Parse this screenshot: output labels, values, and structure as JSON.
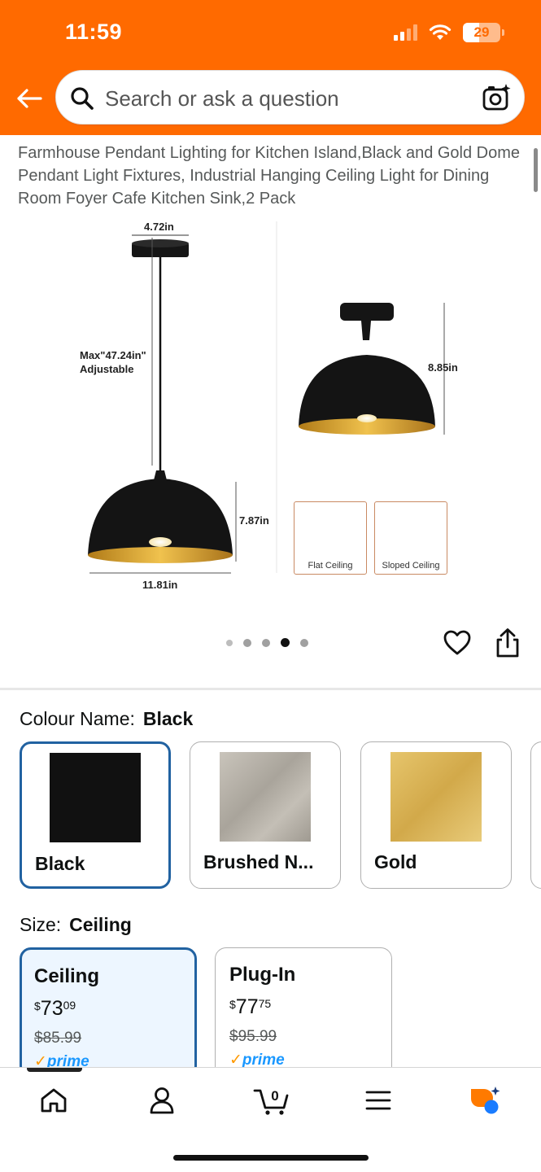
{
  "status_bar": {
    "time": "11:59",
    "battery": "29"
  },
  "search": {
    "placeholder": "Search or ask a question"
  },
  "product": {
    "title": "Farmhouse Pendant Lighting for Kitchen Island,Black and Gold Dome Pendant Light Fixtures, Industrial Hanging Ceiling Light for Dining Room Foyer Cafe Kitchen Sink,2 Pack"
  },
  "product_image": {
    "canopy_width": "4.72in",
    "cord_length": "Max\"47.24in\"",
    "cord_note": "Adjustable",
    "shade_height": "7.87in",
    "shade_width": "11.81in",
    "flush_height": "8.85in",
    "flat_ceiling": "Flat Ceiling",
    "sloped_ceiling": "Sloped Ceiling"
  },
  "carousel": {
    "total": 5,
    "active_index": 3
  },
  "colour": {
    "label": "Colour Name:",
    "selected": "Black",
    "options": [
      {
        "name": "Black",
        "color": "#111111"
      },
      {
        "name": "Brushed N...",
        "color": "#b8b3aa"
      },
      {
        "name": "Gold",
        "color": "#d9b55a"
      }
    ]
  },
  "size": {
    "label": "Size:",
    "selected": "Ceiling",
    "options": [
      {
        "name": "Ceiling",
        "currency": "$",
        "price_whole": "73",
        "price_fraction": "09",
        "was_price": "$85.99",
        "prime": "prime"
      },
      {
        "name": "Plug-In",
        "currency": "$",
        "price_whole": "77",
        "price_fraction": "75",
        "was_price": "$95.99",
        "prime": "prime"
      }
    ]
  },
  "cart": {
    "count": "0"
  },
  "bottom_nav": [
    "home",
    "account",
    "cart",
    "menu",
    "rufus"
  ],
  "colors": {
    "brand_orange": "#ff6a00",
    "selected_border": "#2162a1",
    "prime_blue": "#1a98ff"
  }
}
